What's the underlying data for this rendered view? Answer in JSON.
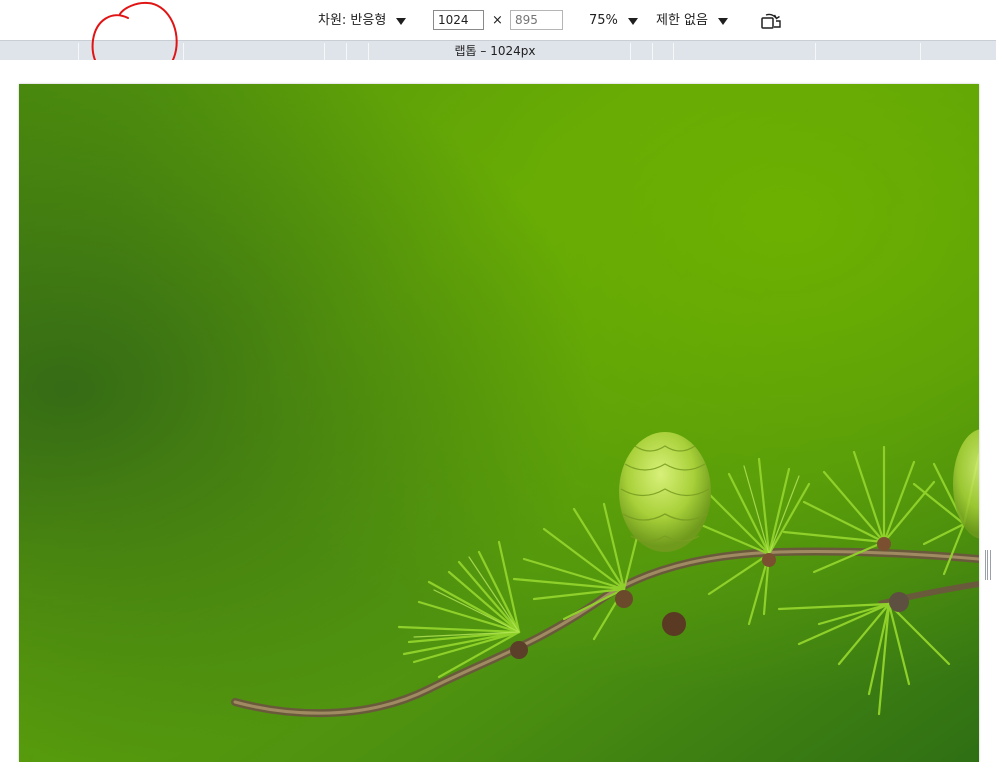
{
  "toolbar": {
    "dimensions_label": "차원: 반응형",
    "width_value": "1024",
    "height_placeholder": "895",
    "times_symbol": "×",
    "zoom_label": "75%",
    "throttle_label": "제한 없음",
    "rotate_icon": "rotate-device-icon"
  },
  "media_query_bar": {
    "label": "랩톱 – 1024px"
  },
  "colors": {
    "annotation_red": "#e01414",
    "mq_bar": "#dfe3ea",
    "leaf_green": "#66b00a"
  }
}
